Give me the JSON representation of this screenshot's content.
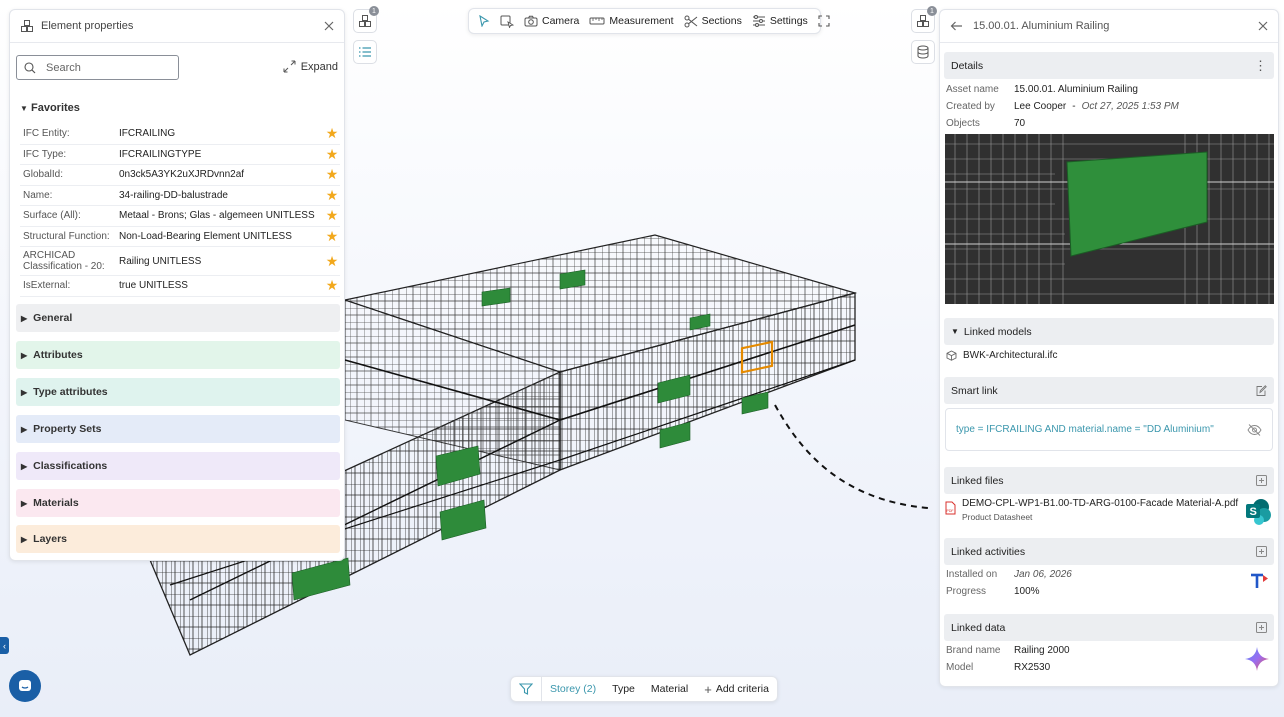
{
  "left_panel": {
    "title": "Element properties",
    "search_placeholder": "Search",
    "expand_label": "Expand",
    "favorites_label": "Favorites",
    "favorites": [
      {
        "key": "IFC Entity:",
        "value": "IFCRAILING"
      },
      {
        "key": "IFC Type:",
        "value": "IFCRAILINGTYPE"
      },
      {
        "key": "GlobalId:",
        "value": "0n3ck5A3YK2uXJRDvnn2af"
      },
      {
        "key": "Name:",
        "value": "34-railing-DD-balustrade"
      },
      {
        "key": "Surface (All):",
        "value": "Metaal - Brons; Glas - algemeen UNITLESS"
      },
      {
        "key": "Structural Function:",
        "value": "Non-Load-Bearing Element UNITLESS"
      },
      {
        "key": "ARCHICAD Classification - 20:",
        "value": "Railing UNITLESS"
      },
      {
        "key": "IsExternal:",
        "value": "true UNITLESS"
      }
    ],
    "sections": [
      {
        "label": "General",
        "color": "#eeeff1"
      },
      {
        "label": "Attributes",
        "color": "#e2f5ea"
      },
      {
        "label": "Type attributes",
        "color": "#dff3ee"
      },
      {
        "label": "Property Sets",
        "color": "#e4ebf8"
      },
      {
        "label": "Classifications",
        "color": "#efe9f9"
      },
      {
        "label": "Materials",
        "color": "#fbe8f0"
      },
      {
        "label": "Layers",
        "color": "#fcecdb"
      }
    ]
  },
  "toolbar": {
    "camera": "Camera",
    "measurement": "Measurement",
    "sections": "Sections",
    "settings": "Settings",
    "badge_left": "1",
    "badge_right": "1"
  },
  "right_panel": {
    "title": "15.00.01. Aluminium Railing",
    "details_label": "Details",
    "asset_name_key": "Asset name",
    "asset_name": "15.00.01. Aluminium Railing",
    "created_by_key": "Created by",
    "created_by": "Lee Cooper",
    "created_sep": "-",
    "created_at": "Oct 27, 2025 1:53 PM",
    "objects_key": "Objects",
    "objects": "70",
    "linked_models_label": "Linked models",
    "linked_model": "BWK-Architectural.ifc",
    "smart_link_label": "Smart link",
    "smart_link_query": "type = IFCRAILING AND material.name = \"DD Aluminium\"",
    "linked_files_label": "Linked files",
    "file_name": "DEMO-CPL-WP1-B1.00-TD-ARG-0100-Facade Material-A.pdf",
    "file_type": "Product Datasheet",
    "linked_activities_label": "Linked activities",
    "installed_on_key": "Installed on",
    "installed_on": "Jan 06, 2026",
    "progress_key": "Progress",
    "progress": "100%",
    "linked_data_label": "Linked data",
    "brand_key": "Brand name",
    "brand": "Railing 2000",
    "model_key": "Model",
    "model": "RX2530"
  },
  "filter_bar": {
    "storey": "Storey (2)",
    "type": "Type",
    "material": "Material",
    "add": "Add criteria"
  },
  "colors": {
    "accent": "#3b97ad",
    "star": "#f2a81c",
    "highlight_green": "#2e8b3a",
    "selection_orange": "#e58a00",
    "brand_blue": "#1a5fa6"
  }
}
